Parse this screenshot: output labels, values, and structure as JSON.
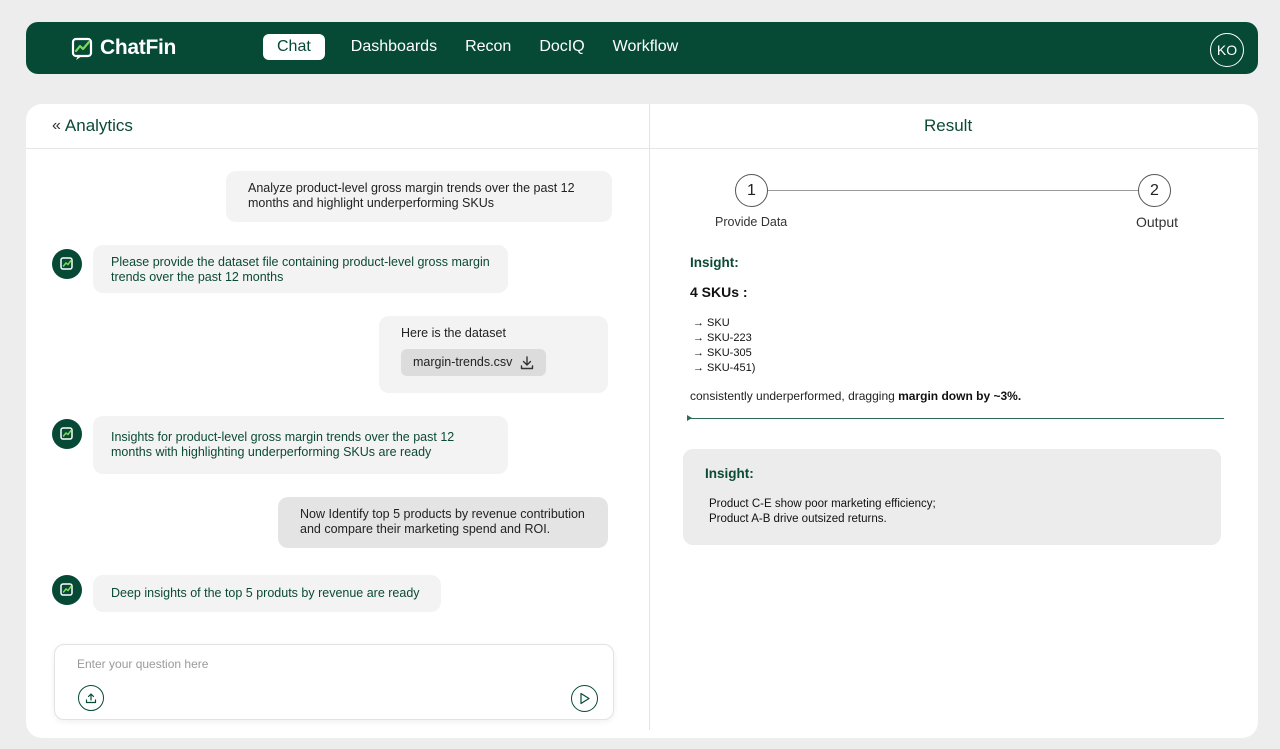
{
  "brand": {
    "name": "ChatFin"
  },
  "nav": {
    "items": [
      {
        "label": "Chat",
        "active": true
      },
      {
        "label": "Dashboards"
      },
      {
        "label": "Recon"
      },
      {
        "label": "DocIQ"
      },
      {
        "label": "Workflow"
      }
    ],
    "avatar_initials": "KO"
  },
  "left_panel": {
    "title": "Analytics",
    "messages": [
      {
        "role": "user",
        "text": "Analyze product-level gross margin trends over the past 12 months and highlight underperforming SKUs"
      },
      {
        "role": "bot",
        "text": "Please provide the dataset file containing product-level gross margin trends over the past 12 months"
      },
      {
        "role": "user",
        "text": "Here is the dataset",
        "file": "margin-trends.csv"
      },
      {
        "role": "bot",
        "text": "Insights for product-level gross margin trends over the past 12 months with highlighting underperforming SKUs are ready"
      },
      {
        "role": "user",
        "text": "Now Identify top 5 products by revenue contribution and compare their marketing spend and ROI."
      },
      {
        "role": "bot",
        "text": "Deep insights of the top 5 produts by revenue are ready"
      }
    ],
    "input_placeholder": "Enter your question here"
  },
  "right_panel": {
    "title": "Result",
    "steps": [
      {
        "number": "1",
        "label": "Provide Data"
      },
      {
        "number": "2",
        "label": "Output"
      }
    ],
    "insight1": {
      "title": "Insight:",
      "count": "4 SKUs :",
      "skus": [
        "→ SKU",
        "→ SKU-223",
        "→ SKU-305",
        "→ SKU-451)"
      ],
      "summary_prefix": "consistently underperformed, dragging ",
      "summary_bold": "margin down by ~3%."
    },
    "insight2": {
      "title": "Insight:",
      "lines": [
        "Product C-E show poor marketing efficiency;",
        "Product A-B drive outsized returns."
      ]
    }
  },
  "colors": {
    "brand": "#064a36",
    "accent_text": "#0b4a35"
  }
}
